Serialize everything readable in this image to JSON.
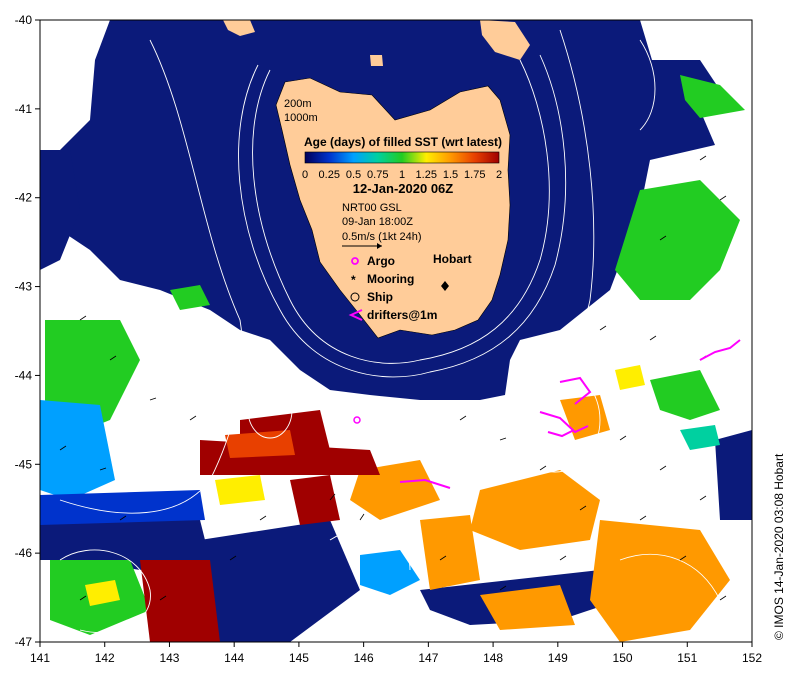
{
  "map": {
    "x_ticks": [
      "141",
      "142",
      "143",
      "144",
      "145",
      "146",
      "147",
      "148",
      "149",
      "150",
      "151",
      "152"
    ],
    "y_ticks": [
      "-40",
      "-41",
      "-42",
      "-43",
      "-44",
      "-45",
      "-46",
      "-47"
    ],
    "lon_range": [
      141,
      152
    ],
    "lat_range": [
      -47,
      -40
    ],
    "colors": {
      "ocean_deep": "#0b1a7a",
      "land": "#ffcc99",
      "no_data": "#ffffff",
      "contour": "#ffffff",
      "drifter": "#ff00ff"
    }
  },
  "legend": {
    "isobath_labels": [
      "200m",
      "1000m"
    ],
    "colorbar_title": "Age (days) of filled SST (wrt latest)",
    "colorbar_ticks": [
      "0",
      "0.25",
      "0.5",
      "0.75",
      "1",
      "1.25",
      "1.5",
      "1.75",
      "2"
    ],
    "colorbar_colors": [
      "#00005a",
      "#0033cc",
      "#00a0ff",
      "#00d0a0",
      "#22cc22",
      "#ffee00",
      "#ff9900",
      "#e84000",
      "#a00000"
    ],
    "date": "12-Jan-2020 06Z",
    "source": "NRT00 GSL",
    "source_time": "09-Jan 18:00Z",
    "scale_label": "0.5m/s (1kt 24h)",
    "place_label": "Hobart",
    "symbols": [
      {
        "label": "Argo",
        "icon": "argo-icon"
      },
      {
        "label": "Mooring",
        "icon": "mooring-icon"
      },
      {
        "label": "Ship",
        "icon": "ship-icon"
      },
      {
        "label": "drifters@1m",
        "icon": "drifter-icon"
      }
    ]
  },
  "credit": "© IMOS 14-Jan-2020 03:08 Hobart"
}
